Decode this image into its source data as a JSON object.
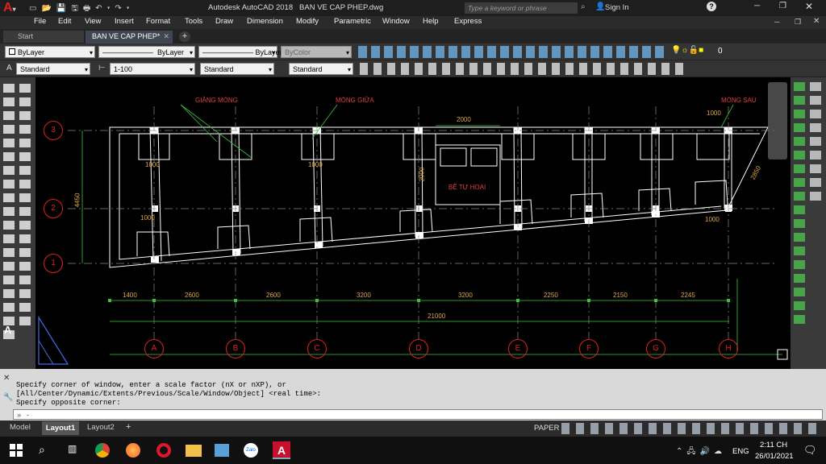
{
  "app": {
    "title": "Autodesk AutoCAD 2018",
    "filename": "BAN VE CAP PHEP.dwg",
    "search_placeholder": "Type a keyword or phrase",
    "sign_in": "Sign In"
  },
  "menu": [
    "File",
    "Edit",
    "View",
    "Insert",
    "Format",
    "Tools",
    "Draw",
    "Dimension",
    "Modify",
    "Parametric",
    "Window",
    "Help",
    "Express"
  ],
  "tabs": {
    "start": "Start",
    "active": "BAN VE CAP PHEP*"
  },
  "properties": {
    "color": "ByLayer",
    "linetype": "ByLayer",
    "lineweight": "ByLayer",
    "plotstyle": "ByColor",
    "layer_zero": "0"
  },
  "styles": {
    "text": "Standard",
    "dimscale": "1-100",
    "dim": "Standard",
    "table": "Standard"
  },
  "drawing": {
    "labels": {
      "giang_mong": "GIẰNG MÓNG",
      "mong_giua": "MÓNG GIỮA",
      "mong_sau": "MÓNG SAU",
      "be_tu_hoai": "BỂ TỰ HOẠI"
    },
    "row_axes": [
      "3",
      "2",
      "1"
    ],
    "col_axes": [
      "A",
      "B",
      "C",
      "D",
      "E",
      "F",
      "G",
      "H"
    ],
    "spans": [
      "1400",
      "2600",
      "2600",
      "3200",
      "3200",
      "2250",
      "2150",
      "2245"
    ],
    "total": "21000",
    "dims": {
      "d2000": "2000",
      "d1000": "1000",
      "d4450": "4450",
      "d1000v": "1000",
      "d2000v": "2000",
      "d2850": "2850"
    }
  },
  "command": {
    "line1": "Specify corner of window, enter a scale factor (nX or nXP), or",
    "line2": "[All/Center/Dynamic/Extents/Previous/Scale/Window/Object] <real time>:",
    "line3": "Specify opposite corner:",
    "prompt": "» -"
  },
  "layout_tabs": [
    "Model",
    "Layout1",
    "Layout2"
  ],
  "status": {
    "paper": "PAPER"
  },
  "taskbar": {
    "lang": "ENG",
    "time": "2:11 CH",
    "date": "26/01/2021"
  }
}
